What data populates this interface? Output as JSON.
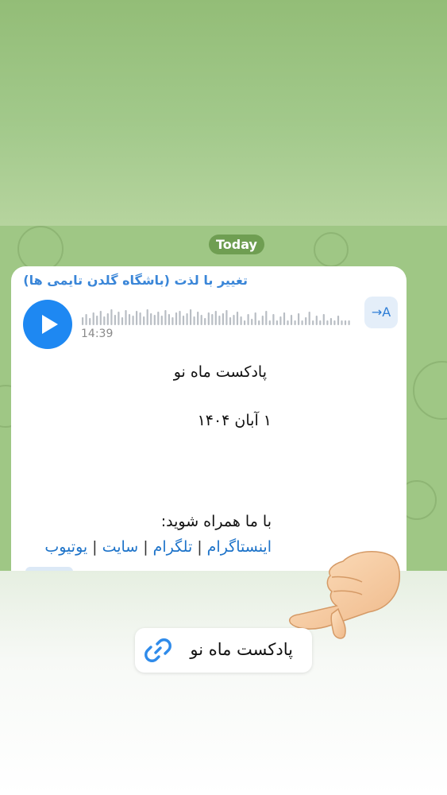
{
  "chat": {
    "date_pill": "Today",
    "message": {
      "sender": "تغییر با لذت (باشگاه گلدن تایمی ها)",
      "voice_duration": "14:39",
      "translate_label": "→A",
      "title": "پادکست ماه نو",
      "date": "۱ آبان ۱۴۰۴",
      "follow_text": "با ما همراه شوید:",
      "links": [
        "اینستاگرام",
        "تلگرام",
        "سایت",
        "یوتیوب"
      ],
      "separator": "|"
    }
  },
  "overlay": {
    "link_label": "پادکست ماه نو",
    "link_icon": "link-icon",
    "pointer_icon": "pointing-hand-icon"
  },
  "colors": {
    "wallpaper": "#9fc785",
    "date_pill": "#6f9e52",
    "accent_blue": "#1e88f2",
    "link_blue": "#1d73c9",
    "sender_blue": "#3a86d8"
  }
}
